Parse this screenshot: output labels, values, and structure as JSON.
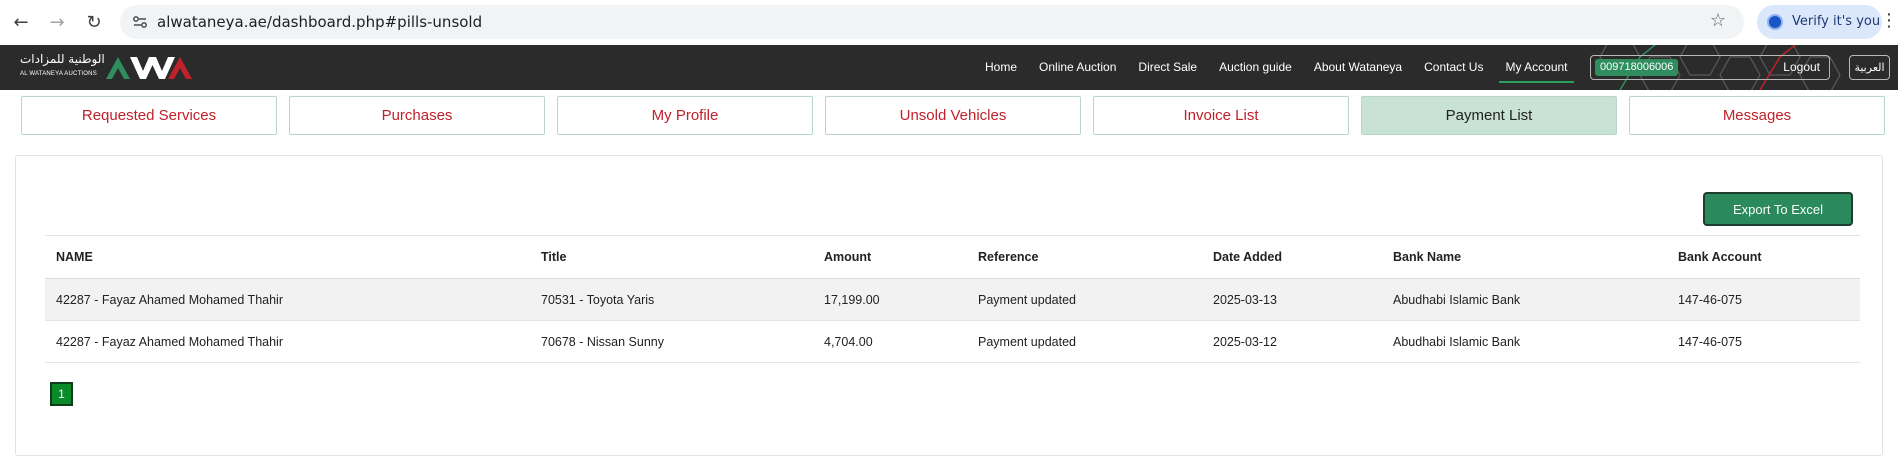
{
  "browser": {
    "url": "alwataneya.ae/dashboard.php#pills-unsold",
    "verify_label": "Verify it's you"
  },
  "header": {
    "logo_arabic": "الوطنية للمزادات",
    "logo_english": "AL WATANEYA AUCTIONS",
    "nav": [
      {
        "label": "Home"
      },
      {
        "label": "Online Auction"
      },
      {
        "label": "Direct Sale"
      },
      {
        "label": "Auction guide"
      },
      {
        "label": "About Wataneya"
      },
      {
        "label": "Contact Us"
      },
      {
        "label": "My Account"
      }
    ],
    "phone": "009718006006",
    "logout": "Logout",
    "language": "العربية",
    "colors": {
      "bar": "#2b2b2b",
      "accent_green": "#2f8d5e",
      "accent_red": "#c0212a"
    }
  },
  "tabs": [
    {
      "label": "Requested Services"
    },
    {
      "label": "Purchases"
    },
    {
      "label": "My Profile"
    },
    {
      "label": "Unsold Vehicles"
    },
    {
      "label": "Invoice List"
    },
    {
      "label": "Payment List"
    },
    {
      "label": "Messages"
    }
  ],
  "active_tab": "Payment List",
  "main": {
    "export_label": "Export To Excel",
    "table": {
      "headers": [
        "NAME",
        "Title",
        "Amount",
        "Reference",
        "Date Added",
        "Bank Name",
        "Bank Account"
      ],
      "rows": [
        [
          "42287 - Fayaz Ahamed Mohamed Thahir",
          "70531 - Toyota Yaris",
          "17,199.00",
          "Payment updated",
          "2025-03-13",
          "Abudhabi Islamic Bank",
          "147-46-075"
        ],
        [
          "42287 - Fayaz Ahamed Mohamed Thahir",
          "70678 - Nissan Sunny",
          "4,704.00",
          "Payment updated",
          "2025-03-12",
          "Abudhabi Islamic Bank",
          "147-46-075"
        ]
      ]
    },
    "pagination": {
      "current_page": "1"
    }
  }
}
